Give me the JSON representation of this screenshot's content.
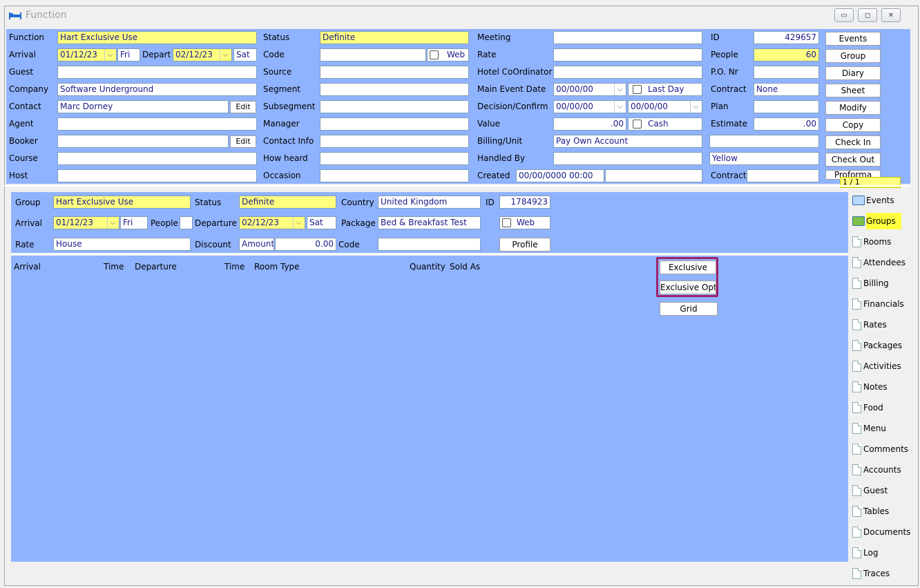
{
  "window": {
    "title": "Function"
  },
  "col1": {
    "function_label": "Function",
    "function_value": "Hart Exclusive Use",
    "arrival_label": "Arrival",
    "arrival_value": "01/12/23",
    "arrival_day": "Fri",
    "depart_label": "Depart",
    "depart_value": "02/12/23",
    "depart_day": "Sat",
    "guest_label": "Guest",
    "company_label": "Company",
    "company_value": "Software Underground",
    "contact_label": "Contact",
    "contact_value": "Marc Dorney",
    "edit_label": "Edit",
    "agent_label": "Agent",
    "booker_label": "Booker",
    "course_label": "Course",
    "host_label": "Host"
  },
  "col2": {
    "status_label": "Status",
    "status_value": "Definite",
    "code_label": "Code",
    "web_label": "Web",
    "source_label": "Source",
    "segment_label": "Segment",
    "subsegment_label": "Subsegment",
    "manager_label": "Manager",
    "contact_info_label": "Contact Info",
    "how_heard_label": "How heard",
    "occasion_label": "Occasion"
  },
  "col3": {
    "meeting_label": "Meeting",
    "rate_label": "Rate",
    "hotel_coord_label": "Hotel CoOrdinator",
    "main_event_label": "Main Event Date",
    "main_event_value": "00/00/00",
    "last_day_label": "Last Day",
    "decision_label": "Decision/Confirm",
    "decision_value1": "00/00/00",
    "decision_value2": "00/00/00",
    "value_label": "Value",
    "value_value": ".00",
    "cash_label": "Cash",
    "billing_label": "Billing/Unit",
    "billing_value": "Pay Own Account",
    "handled_label": "Handled By",
    "created_label": "Created",
    "created_value": "00/00/0000 00:00"
  },
  "col4": {
    "id_label": "ID",
    "id_value": "429657",
    "people_label": "People",
    "people_value": "60",
    "po_label": "P.O. Nr",
    "contract_label": "Contract",
    "contract_value": "None",
    "plan_label": "Plan",
    "estimate_label": "Estimate",
    "estimate_value": ".00",
    "color_value": "Yellow",
    "contract2_label": "Contract",
    "pager": "1 / 1"
  },
  "actions": [
    "Events",
    "Group",
    "Diary",
    "Sheet",
    "Modify",
    "Copy",
    "Check In",
    "Check Out",
    "Proforma"
  ],
  "group": {
    "group_label": "Group",
    "group_value": "Hart Exclusive Use",
    "status_label": "Status",
    "status_value": "Definite",
    "country_label": "Country",
    "country_value": "United Kingdom",
    "id_label": "ID",
    "id_value": "1784923",
    "arrival_label": "Arrival",
    "arrival_value": "01/12/23",
    "arrival_day": "Fri",
    "people_label": "People",
    "departure_label": "Departure",
    "departure_value": "02/12/23",
    "departure_day": "Sat",
    "package_label": "Package",
    "package_value": "Bed & Breakfast Test",
    "web_label": "Web",
    "rate_label": "Rate",
    "rate_value": "House",
    "discount_label": "Discount",
    "discount_type": "Amount",
    "discount_value": "0.00",
    "code_label": "Code",
    "profile_label": "Profile"
  },
  "table": {
    "headers": {
      "arrival": "Arrival",
      "time1": "Time",
      "departure": "Departure",
      "time2": "Time",
      "room_type": "Room Type",
      "quantity": "Quantity",
      "sold_as": "Sold As"
    }
  },
  "grid_buttons": {
    "exclusive": "Exclusive",
    "exclusive_opt": "Exclusive Opt",
    "grid": "Grid"
  },
  "sidebar": [
    "Events",
    "Groups",
    "Rooms",
    "Attendees",
    "Billing",
    "Financials",
    "Rates",
    "Packages",
    "Activities",
    "Notes",
    "Food",
    "Menu",
    "Comments",
    "Accounts",
    "Guest",
    "Tables",
    "Documents",
    "Log",
    "Traces"
  ],
  "colors": {
    "panel": "#90b3ff",
    "highlight": "#ffff80",
    "frame": "#a0216b"
  }
}
